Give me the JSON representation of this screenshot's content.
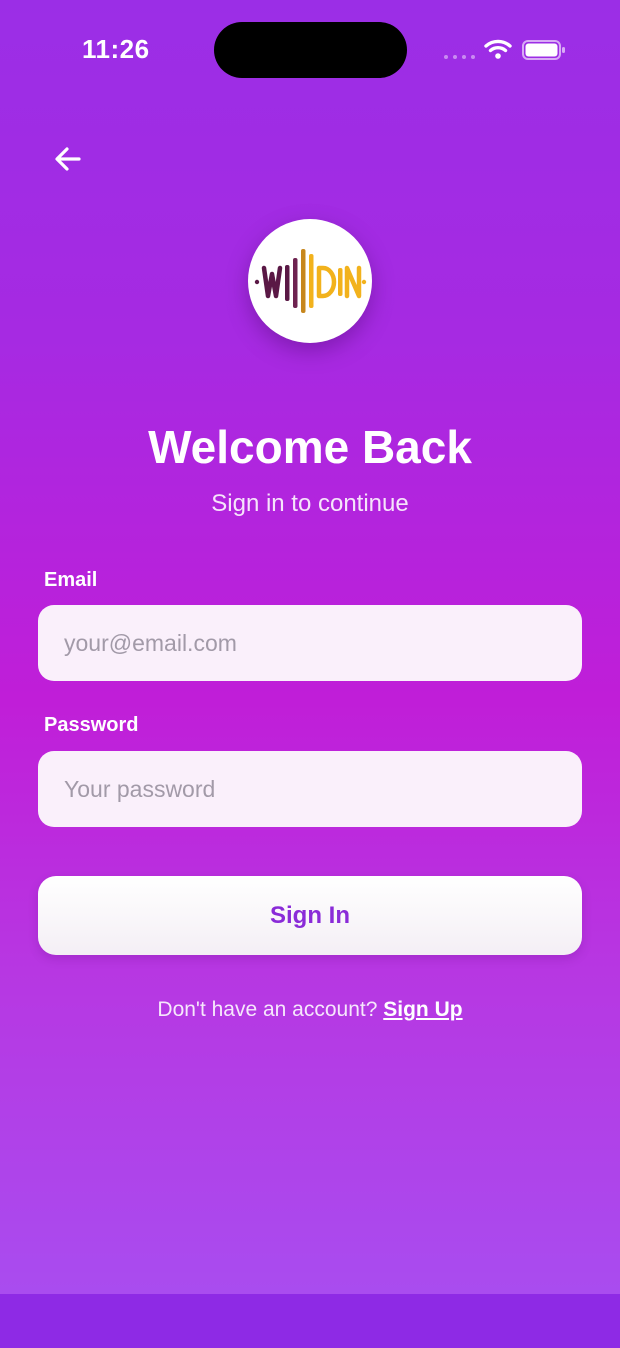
{
  "status_bar": {
    "time": "11:26",
    "icons": [
      "cellular-signal-icon",
      "wifi-icon",
      "battery-icon"
    ]
  },
  "header": {
    "back_icon": "arrow-left-icon"
  },
  "logo": {
    "text": "WIIDIN",
    "colors": {
      "dark": "#5a1845",
      "accent": "#f2b21c"
    }
  },
  "hero": {
    "title": "Welcome Back",
    "subtitle": "Sign in to continue"
  },
  "form": {
    "email": {
      "label": "Email",
      "placeholder": "your@email.com",
      "value": ""
    },
    "password": {
      "label": "Password",
      "placeholder": "Your password",
      "value": ""
    },
    "submit_label": "Sign In"
  },
  "footer": {
    "prompt": "Don't have an account?",
    "link_label": "Sign Up"
  },
  "colors": {
    "gradient_top": "#9b2ee6",
    "gradient_mid": "#c01ed8",
    "gradient_bottom": "#a94cef",
    "button_text": "#8a2bd8",
    "field_background": "#faf0fb"
  }
}
